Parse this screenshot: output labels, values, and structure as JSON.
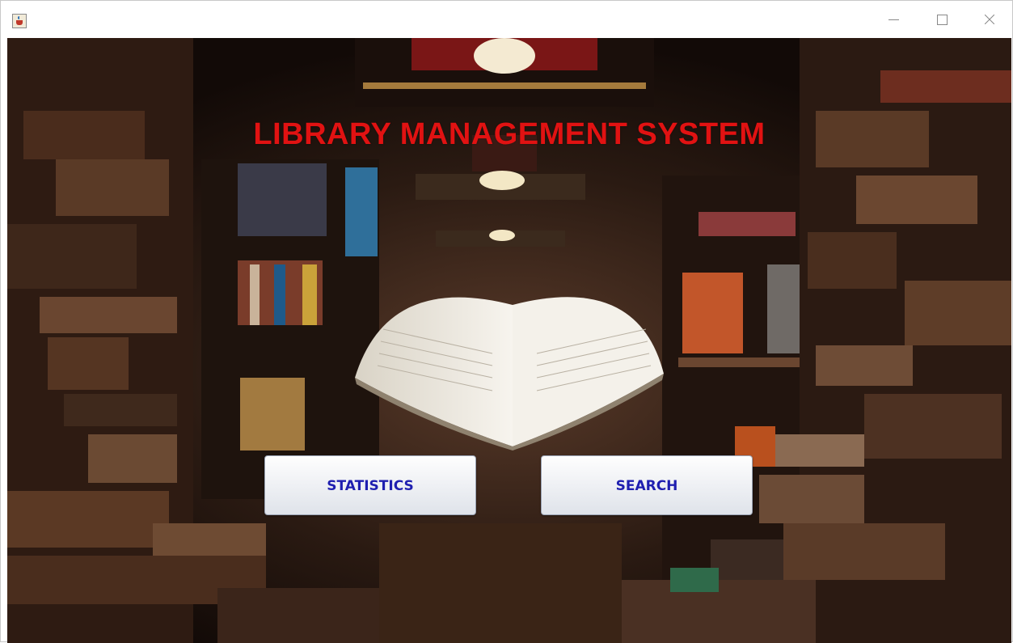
{
  "window": {
    "icon": "java-cup-icon",
    "controls": [
      "minimize-icon",
      "maximize-icon",
      "close-icon"
    ]
  },
  "main": {
    "title": "LIBRARY MANAGEMENT SYSTEM",
    "background": "library-bookshelves-with-open-book",
    "title_color": "#e11212",
    "buttons": {
      "statistics_label": "STATISTICS",
      "search_label": "SEARCH",
      "label_color": "#1f1fb0"
    }
  }
}
